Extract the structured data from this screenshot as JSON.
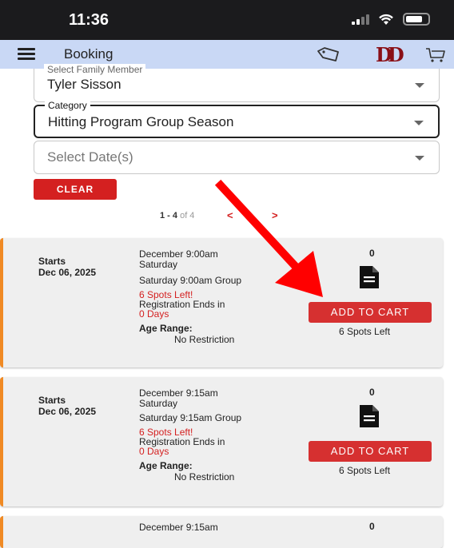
{
  "status_bar": {
    "time": "11:36"
  },
  "app_bar": {
    "title": "Booking",
    "logo_text": "DD"
  },
  "form": {
    "family_member": {
      "legend": "Select Family Member",
      "value": "Tyler Sisson"
    },
    "category": {
      "legend": "Category",
      "value": "Hitting Program Group Season"
    },
    "dates": {
      "placeholder": "Select Date(s)"
    },
    "clear_label": "CLEAR"
  },
  "pager": {
    "range": "1 - 4",
    "of_text": "of 4",
    "prev": "<",
    "next": ">"
  },
  "cards": [
    {
      "starts_label": "Starts",
      "start_date": "Dec 06, 2025",
      "time_title": "December 9:00am",
      "weekday": "Saturday",
      "group_name": "Saturday 9:00am Group",
      "spots_text": "6 Spots Left!",
      "reg_ends": "Registration Ends in",
      "days": "0 Days",
      "age_label": "Age Range:",
      "age_value": "No Restriction",
      "count": "0",
      "add_label": "ADD TO CART",
      "spots_left": "6 Spots Left"
    },
    {
      "starts_label": "Starts",
      "start_date": "Dec 06, 2025",
      "time_title": "December 9:15am",
      "weekday": "Saturday",
      "group_name": "Saturday 9:15am Group",
      "spots_text": "6 Spots Left!",
      "reg_ends": "Registration Ends in",
      "days": "0 Days",
      "age_label": "Age Range:",
      "age_value": "No Restriction",
      "count": "0",
      "add_label": "ADD TO CART",
      "spots_left": "6 Spots Left"
    },
    {
      "time_title": "December 9:15am",
      "count": "0"
    }
  ],
  "colors": {
    "accent_red": "#d42020",
    "card_border": "#f08a24",
    "appbar": "#c9d8f5",
    "annotation_arrow": "#ff0000"
  },
  "icons": {
    "menu": "hamburger-icon",
    "tag": "tag-icon",
    "cart": "cart-icon",
    "document": "document-icon",
    "chevron": "chevron-down-icon"
  }
}
